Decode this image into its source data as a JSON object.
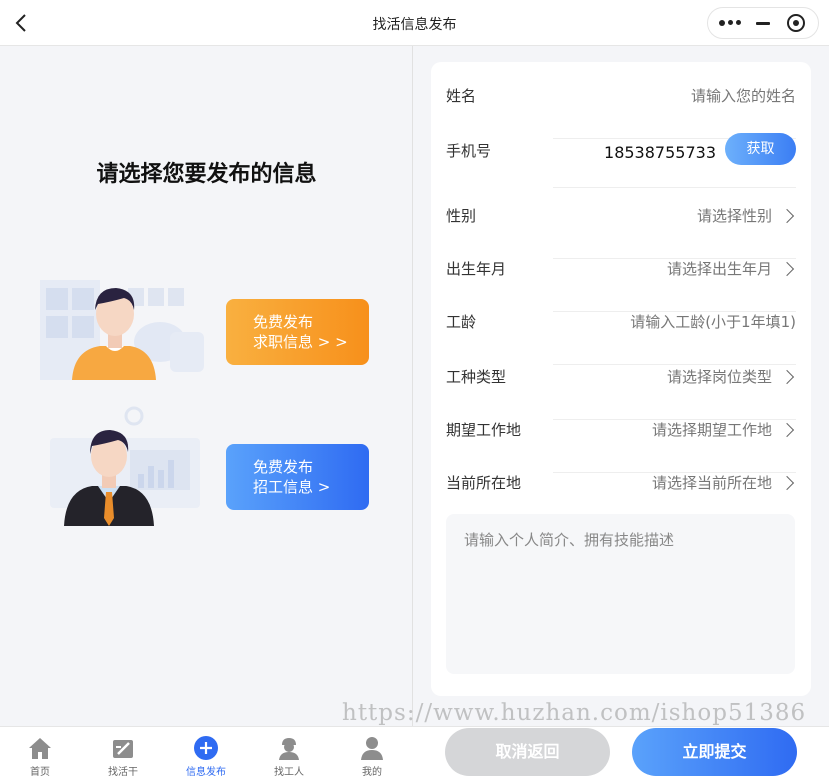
{
  "nav": {
    "title": "找活信息发布"
  },
  "left": {
    "heading": "请选择您要发布的信息",
    "job_seek": {
      "line1": "免费发布",
      "line2": "求职信息 > >"
    },
    "hire": {
      "line1": "免费发布",
      "line2": "招工信息 >"
    }
  },
  "form": {
    "name": {
      "label": "姓名",
      "placeholder": "请输入您的姓名"
    },
    "phone": {
      "label": "手机号",
      "value": "18538755733",
      "button": "获取"
    },
    "gender": {
      "label": "性别",
      "placeholder": "请选择性别"
    },
    "birth": {
      "label": "出生年月",
      "placeholder": "请选择出生年月"
    },
    "seniority": {
      "label": "工龄",
      "placeholder": "请输入工龄(小于1年填1)"
    },
    "trade": {
      "label": "工种类型",
      "placeholder": "请选择岗位类型"
    },
    "expected_location": {
      "label": "期望工作地",
      "placeholder": "请选择期望工作地"
    },
    "current_location": {
      "label": "当前所在地",
      "placeholder": "请选择当前所在地"
    },
    "intro_placeholder": "请输入个人简介、拥有技能描述"
  },
  "tabs": [
    {
      "label": "首页",
      "icon": "home-icon"
    },
    {
      "label": "找活干",
      "icon": "find-work-icon"
    },
    {
      "label": "信息发布",
      "icon": "plus-icon"
    },
    {
      "label": "找工人",
      "icon": "worker-icon"
    },
    {
      "label": "我的",
      "icon": "user-icon"
    }
  ],
  "actions": {
    "cancel": "取消返回",
    "submit": "立即提交"
  },
  "watermark": "https://www.huzhan.com/ishop51386",
  "colors": {
    "accent": "#2f6bf2",
    "orange": "#f7901b"
  }
}
